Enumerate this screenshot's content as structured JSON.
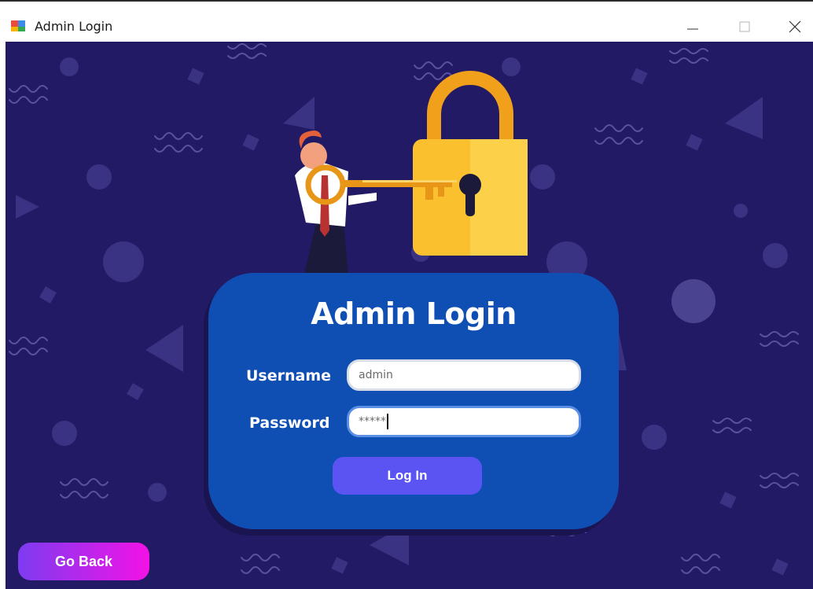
{
  "window": {
    "title": "Admin Login",
    "icon": "app-window-icon",
    "controls": [
      "minimize-icon",
      "maximize-icon",
      "close-icon"
    ]
  },
  "login_card": {
    "heading": "Admin Login",
    "username": {
      "label": "Username",
      "value": "admin"
    },
    "password": {
      "label": "Password",
      "value": "*****"
    },
    "login_button": "Log In"
  },
  "go_back_button": "Go Back",
  "colors": {
    "background": "#231a66",
    "card": "#0f4fb4",
    "login_button": "#5b54f2",
    "go_back_gradient_start": "#7d3cf0",
    "go_back_gradient_end": "#f312e6",
    "lock_body": "#fbc02d",
    "lock_shackle": "#f0a01a"
  }
}
